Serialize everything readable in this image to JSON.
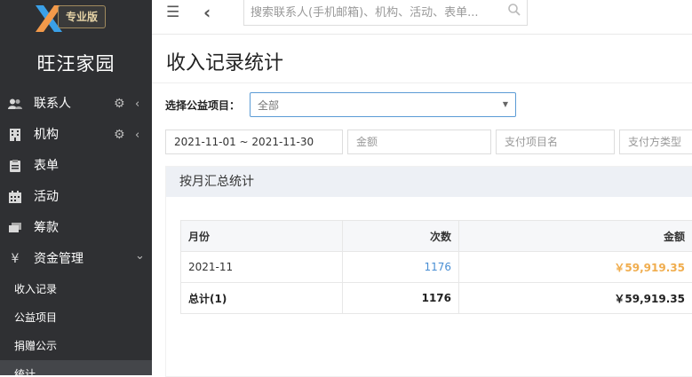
{
  "app": {
    "edition": "专业版",
    "name": "旺汪家园"
  },
  "sidebar": {
    "items": [
      {
        "label": "联系人",
        "icon": "contacts-icon",
        "gear": true,
        "chevron": "‹"
      },
      {
        "label": "机构",
        "icon": "building-icon",
        "gear": true,
        "chevron": "‹"
      },
      {
        "label": "表单",
        "icon": "clipboard-icon",
        "gear": false,
        "chevron": ""
      },
      {
        "label": "活动",
        "icon": "calendar-icon",
        "gear": false,
        "chevron": ""
      },
      {
        "label": "筹款",
        "icon": "money-icon",
        "gear": false,
        "chevron": ""
      },
      {
        "label": "资金管理",
        "icon": "yen-icon",
        "gear": false,
        "chevron": "⌄"
      }
    ],
    "sub_items": [
      {
        "label": "收入记录",
        "active": false
      },
      {
        "label": "公益项目",
        "active": false
      },
      {
        "label": "捐赠公示",
        "active": false
      },
      {
        "label": "统计",
        "active": true
      }
    ]
  },
  "topbar": {
    "search_placeholder": "搜索联系人(手机邮箱)、机构、活动、表单..."
  },
  "page": {
    "title": "收入记录统计"
  },
  "filters": {
    "project_label": "选择公益项目：",
    "project_value": "全部",
    "date_range": "2021-11-01 ~ 2021-11-30",
    "amount_placeholder": "金额",
    "item_name_placeholder": "支付项目名",
    "payment_type_placeholder": "支付方类型"
  },
  "panel": {
    "title": "按月汇总统计",
    "columns": [
      "月份",
      "次数",
      "金额"
    ],
    "rows": [
      {
        "month": "2021-11",
        "count": "1176",
        "amount": "￥59,919.35"
      }
    ],
    "total": {
      "label": "总计(1)",
      "count": "1176",
      "amount": "￥59,919.35"
    }
  },
  "colors": {
    "sidebar_bg": "#2f3033",
    "accent_blue": "#4a8fd4",
    "amount_orange": "#f0ad4e",
    "badge_gold": "#e6d3a6"
  }
}
